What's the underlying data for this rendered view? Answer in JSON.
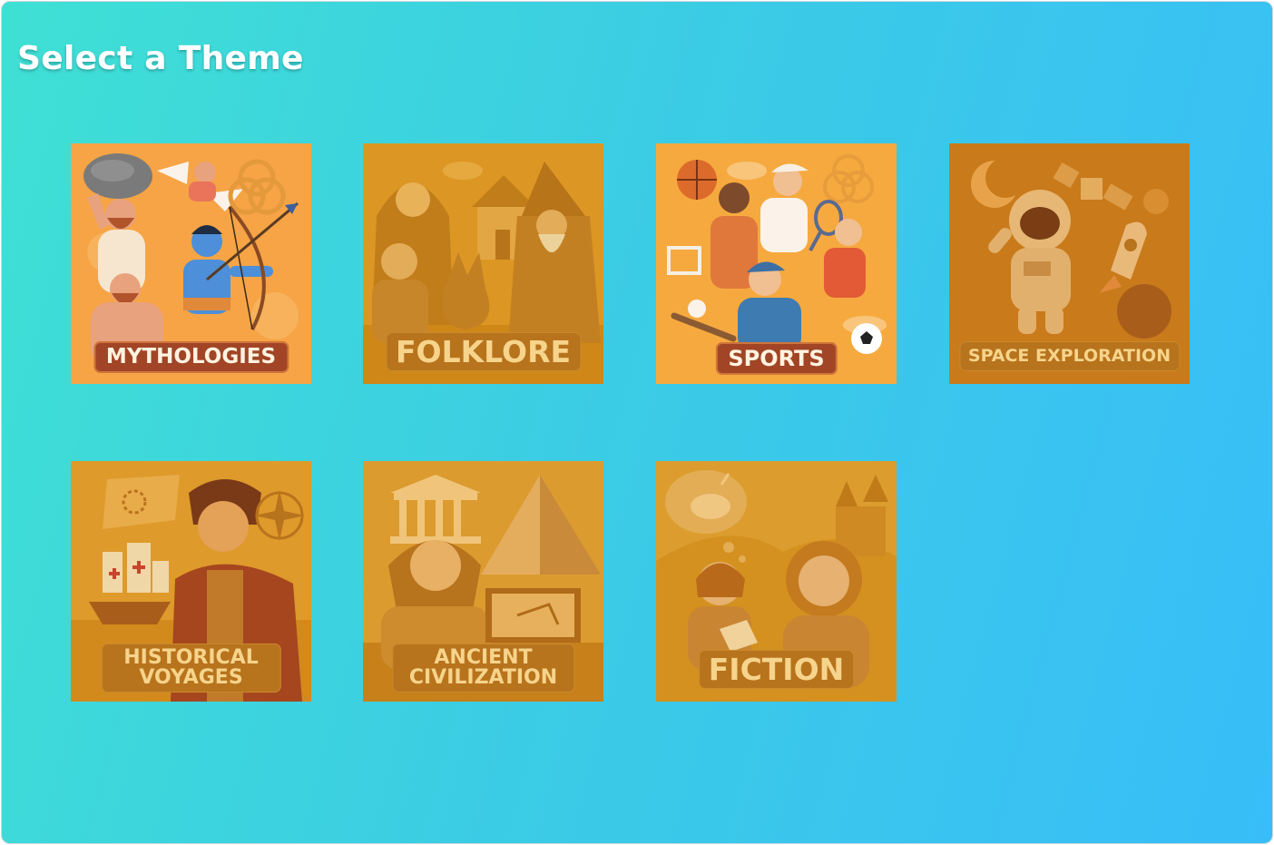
{
  "page": {
    "title": "Select a Theme"
  },
  "themes": [
    {
      "id": "mythologies",
      "label": "MYTHOLOGIES",
      "state": "selected",
      "icons": [
        "boulder-icon",
        "cupid-icon",
        "archer-icon",
        "triquetra-icon"
      ]
    },
    {
      "id": "folklore",
      "label": "FOLKLORE",
      "state": "dimmed",
      "icons": [
        "hooded-woman-icon",
        "cottage-icon",
        "wizard-icon",
        "fox-icon"
      ]
    },
    {
      "id": "sports",
      "label": "SPORTS",
      "state": "selected",
      "icons": [
        "basketball-icon",
        "tennis-racket-icon",
        "soccer-ball-icon",
        "baseball-icon"
      ]
    },
    {
      "id": "space-exploration",
      "label": "SPACE EXPLORATION",
      "state": "dimmed",
      "icons": [
        "moon-icon",
        "satellite-icon",
        "astronaut-icon",
        "rocket-icon",
        "planet-icon"
      ]
    },
    {
      "id": "historical-voyages",
      "label_lines": [
        "HISTORICAL",
        "VOYAGES"
      ],
      "state": "dimmed",
      "icons": [
        "treasure-map-icon",
        "sailing-ship-icon",
        "explorer-icon",
        "compass-rose-icon"
      ]
    },
    {
      "id": "ancient-civilization",
      "label_lines": [
        "ANCIENT",
        "CIVILIZATION"
      ],
      "state": "dimmed",
      "icons": [
        "greek-temple-icon",
        "pyramid-icon",
        "pharaoh-icon",
        "mural-icon"
      ]
    },
    {
      "id": "fiction",
      "label": "FICTION",
      "state": "dimmed",
      "icons": [
        "unicorn-thought-icon",
        "castle-icon",
        "reading-girl-icon",
        "astronaut-icon"
      ]
    }
  ],
  "colors": {
    "background_start": "#3fe0d4",
    "background_end": "#38bdf8",
    "tile_active": "#f5a23e",
    "tile_dim": "#d9911e",
    "label_active_bg": "#a14526",
    "label_dim_bg": "#b8731d"
  }
}
